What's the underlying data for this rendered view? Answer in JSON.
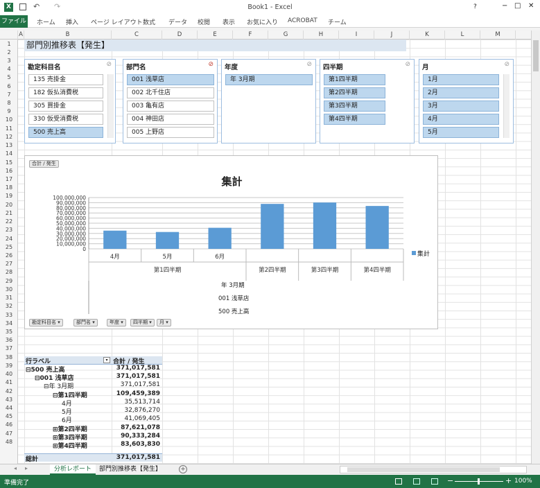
{
  "window": {
    "title": "Book1 - Excel",
    "controls": [
      "?",
      "−",
      "□",
      "✕"
    ]
  },
  "ribbon": {
    "file": "ファイル",
    "tabs": [
      "ホーム",
      "挿入",
      "ページ レイアウト",
      "数式",
      "データ",
      "校閲",
      "表示",
      "お気に入り",
      "ACROBAT",
      "チーム"
    ]
  },
  "columns": [
    "A",
    "B",
    "C",
    "D",
    "E",
    "F",
    "G",
    "H",
    "I",
    "J",
    "K",
    "L",
    "M"
  ],
  "rows": [
    "1",
    "2",
    "3",
    "4",
    "5",
    "6",
    "7",
    "8",
    "9",
    "10",
    "11",
    "12",
    "13",
    "14",
    "15",
    "16",
    "17",
    "18",
    "19",
    "20",
    "21",
    "22",
    "23",
    "24",
    "25",
    "26",
    "27",
    "28",
    "29",
    "30",
    "31",
    "32",
    "33",
    "34",
    "35",
    "36",
    "37",
    "38",
    "39",
    "40",
    "41",
    "42",
    "43",
    "44",
    "45",
    "46",
    "47",
    "48"
  ],
  "sheet_title": "部門別推移表【発生】",
  "slicers": [
    {
      "title": "勘定科目名",
      "items": [
        {
          "label": "135 売掛金",
          "selected": false
        },
        {
          "label": "182 仮払消費税",
          "selected": false
        },
        {
          "label": "305 買掛金",
          "selected": false
        },
        {
          "label": "330 仮受消費税",
          "selected": false
        },
        {
          "label": "500 売上高",
          "selected": true
        }
      ]
    },
    {
      "title": "部門名",
      "items": [
        {
          "label": "001 浅草店",
          "selected": true
        },
        {
          "label": "002 北千住店",
          "selected": false
        },
        {
          "label": "003 亀有店",
          "selected": false
        },
        {
          "label": "004 神田店",
          "selected": false
        },
        {
          "label": "005 上野店",
          "selected": false
        }
      ]
    },
    {
      "title": "年度",
      "items": [
        {
          "label": "年 3月期",
          "selected": true
        }
      ]
    },
    {
      "title": "四半期",
      "items": [
        {
          "label": "第1四半期",
          "selected": true
        },
        {
          "label": "第2四半期",
          "selected": true
        },
        {
          "label": "第3四半期",
          "selected": true
        },
        {
          "label": "第4四半期",
          "selected": true
        }
      ]
    },
    {
      "title": "月",
      "items": [
        {
          "label": "1月",
          "selected": true
        },
        {
          "label": "2月",
          "selected": true
        },
        {
          "label": "3月",
          "selected": true
        },
        {
          "label": "4月",
          "selected": true
        },
        {
          "label": "5月",
          "selected": true
        }
      ]
    }
  ],
  "chart_data": {
    "type": "bar",
    "title": "集計",
    "tag": "合計 / 発生",
    "categories": [
      "4月",
      "5月",
      "6月",
      "第2四半期",
      "第3四半期",
      "第4四半期"
    ],
    "group_label": "第1四半期",
    "series": [
      {
        "name": "集計",
        "values": [
          35513714,
          32876270,
          41069405,
          87621078,
          90333284,
          83603830
        ],
        "color": "#5b9bd5"
      }
    ],
    "ylim": [
      0,
      100000000
    ],
    "yticks": [
      "100,000,000",
      "90,000,000",
      "80,000,000",
      "70,000,000",
      "60,000,000",
      "50,000,000",
      "40,000,000",
      "30,000,000",
      "20,000,000",
      "10,000,000",
      "0"
    ],
    "sub_labels": [
      "年 3月期",
      "001 浅草店",
      "500 売上高"
    ],
    "filter_buttons": [
      "勘定科目名",
      "部門名",
      "年度",
      "四半期",
      "月"
    ]
  },
  "pivot": {
    "header": [
      "行ラベル",
      "合計 / 発生"
    ],
    "rows": [
      {
        "label": "⊟500 売上高",
        "value": "371,017,581",
        "bold": true,
        "indent": 0
      },
      {
        "label": "⊟001 浅草店",
        "value": "371,017,581",
        "bold": true,
        "indent": 1
      },
      {
        "label": "⊟年 3月期",
        "value": "371,017,581",
        "bold": false,
        "indent": 2
      },
      {
        "label": "⊟第1四半期",
        "value": "109,459,389",
        "bold": true,
        "indent": 3
      },
      {
        "label": "4月",
        "value": "35,513,714",
        "bold": false,
        "indent": 4
      },
      {
        "label": "5月",
        "value": "32,876,270",
        "bold": false,
        "indent": 4
      },
      {
        "label": "6月",
        "value": "41,069,405",
        "bold": false,
        "indent": 4
      },
      {
        "label": "⊞第2四半期",
        "value": "87,621,078",
        "bold": true,
        "indent": 3
      },
      {
        "label": "⊞第3四半期",
        "value": "90,333,284",
        "bold": true,
        "indent": 3
      },
      {
        "label": "⊞第4四半期",
        "value": "83,603,830",
        "bold": true,
        "indent": 3
      }
    ],
    "total": {
      "label": "総計",
      "value": "371,017,581"
    }
  },
  "sheets": [
    "分析レポート",
    "部門別推移表【発生】"
  ],
  "status": {
    "text": "準備完了",
    "zoom": "100%"
  }
}
